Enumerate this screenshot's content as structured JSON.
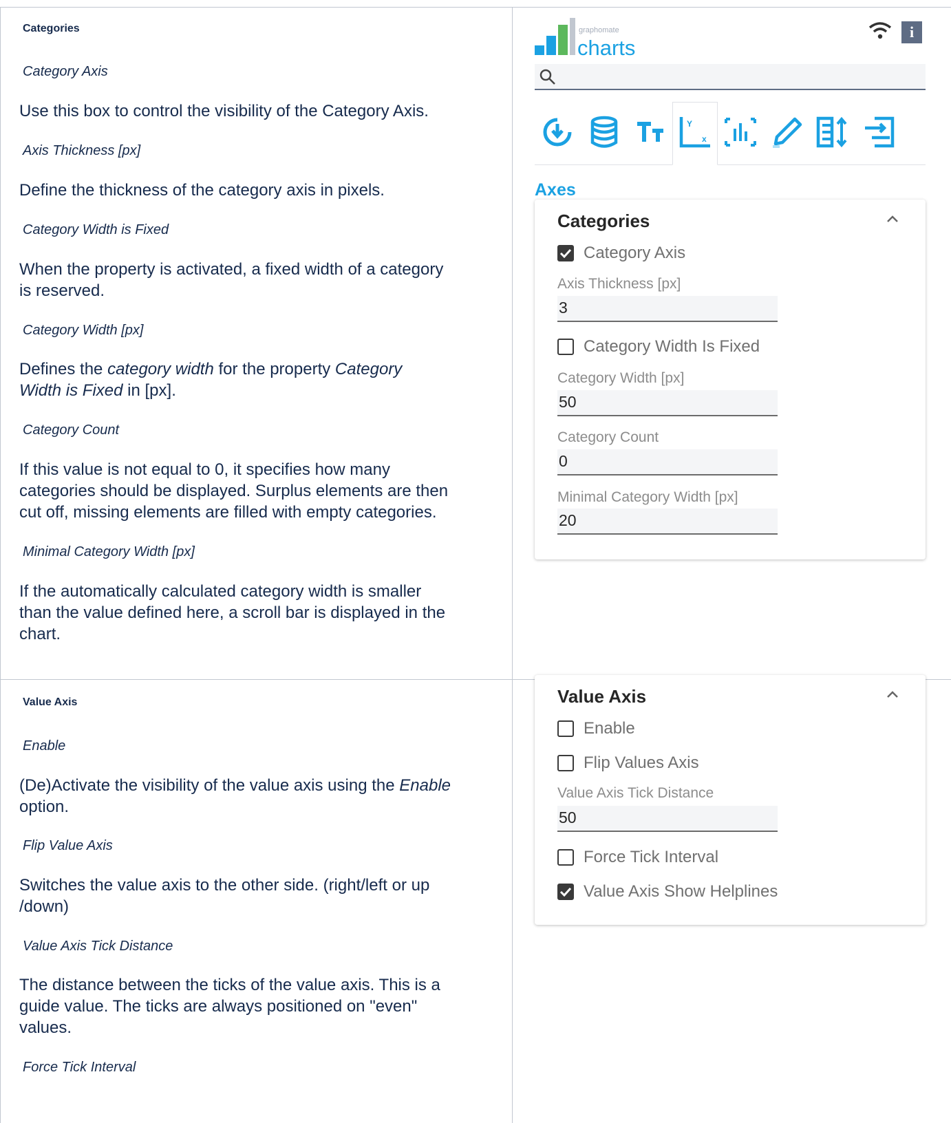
{
  "categories_doc": {
    "section_title": "Categories",
    "items": [
      {
        "title": "Category Axis",
        "text": "Use this box to control the visibility of the Category Axis."
      },
      {
        "title": "Axis Thickness [px]",
        "text": "Define the thickness of the category axis in pixels."
      },
      {
        "title": "Category Width is Fixed",
        "text_line1": "When the property is activated, a fixed width of a category",
        "text_line2": "is reserved."
      },
      {
        "title": "Category Width [px]",
        "text_a": "Defines the ",
        "text_b": "category width",
        "text_c": " for the property ",
        "text_d": "Category",
        "text_e": "Width is Fixed",
        "text_f": " in [px]."
      },
      {
        "title": "Category Count",
        "text_line1": "If this value is not equal to 0, it specifies how many",
        "text_line2": "categories should be displayed. Surplus elements are then",
        "text_line3": "cut off, missing elements are filled with empty categories."
      },
      {
        "title": "Minimal Category Width [px]",
        "text_line1": "If the automatically calculated category width is smaller",
        "text_line2": "than the value defined here, a scroll bar is displayed in the",
        "text_line3": "chart."
      }
    ]
  },
  "value_axis_doc": {
    "section_title": "Value Axis",
    "items": [
      {
        "title": "Enable",
        "text_a": "(De)Activate the visibility of the value axis using the ",
        "text_b": "Enable",
        "text_c": "option."
      },
      {
        "title": "Flip Value Axis",
        "text_line1": "Switches the value axis to the other side. (right/left or up",
        "text_line2": "/down)"
      },
      {
        "title": "Value Axis Tick Distance",
        "text_line1": "The distance between the ticks of the value axis. This is a",
        "text_line2": "guide value. The ticks are always positioned on \"even\"",
        "text_line3": "values."
      },
      {
        "title": "Force Tick Interval"
      }
    ]
  },
  "panel": {
    "logo_small": "graphomate",
    "logo_big": "charts",
    "info_label": "i",
    "search_placeholder": "",
    "tabs": [
      "data-binding-icon",
      "database-icon",
      "text-icon",
      "axes-icon",
      "chart-elements-icon",
      "pencil-icon",
      "layout-icon",
      "import-export-icon"
    ],
    "active_tab": "axes-icon",
    "section_heading": "Axes",
    "accent_color": "#1ba1e2",
    "categories_card": {
      "title": "Categories",
      "category_axis": {
        "label": "Category Axis",
        "checked": true
      },
      "axis_thickness": {
        "label": "Axis Thickness [px]",
        "value": "3"
      },
      "category_width_fixed": {
        "label": "Category Width Is Fixed",
        "checked": false
      },
      "category_width": {
        "label": "Category Width [px]",
        "value": "50"
      },
      "category_count": {
        "label": "Category Count",
        "value": "0"
      },
      "min_category_width": {
        "label": "Minimal Category Width [px]",
        "value": "20"
      }
    },
    "value_axis_card": {
      "title": "Value Axis",
      "enable": {
        "label": "Enable",
        "checked": false
      },
      "flip": {
        "label": "Flip Values Axis",
        "checked": false
      },
      "tick_distance": {
        "label": "Value Axis Tick Distance",
        "value": "50"
      },
      "force_tick": {
        "label": "Force Tick Interval",
        "checked": false
      },
      "helplines": {
        "label": "Value Axis Show Helplines",
        "checked": true
      }
    }
  }
}
